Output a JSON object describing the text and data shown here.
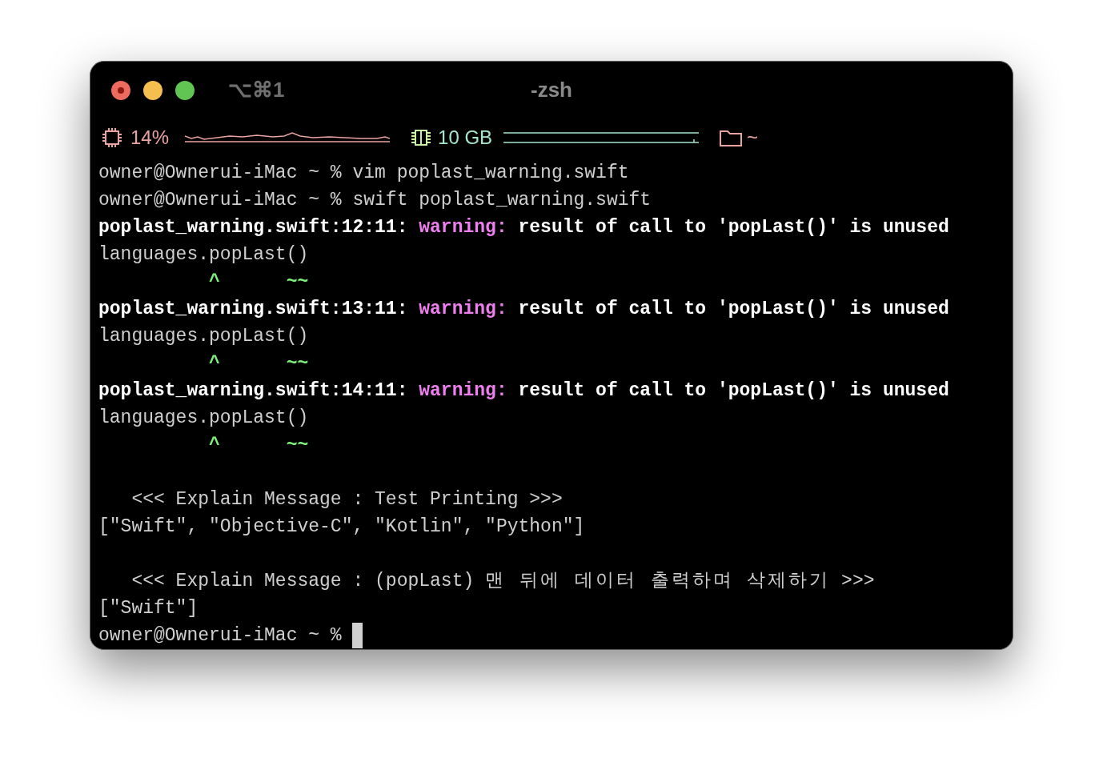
{
  "window": {
    "shortcut": "⌥⌘1",
    "title": "-zsh"
  },
  "status_bar": {
    "cpu": "14%",
    "memory": "10 GB",
    "directory": "~"
  },
  "lines": [
    {
      "segments": [
        {
          "kind": "plain",
          "text": "owner@Ownerui-iMac ~ % vim poplast_warning.swift"
        }
      ]
    },
    {
      "segments": [
        {
          "kind": "plain",
          "text": "owner@Ownerui-iMac ~ % swift poplast_warning.swift"
        }
      ]
    },
    {
      "segments": [
        {
          "kind": "bold",
          "text": "poplast_warning.swift:12:11: "
        },
        {
          "kind": "warning",
          "text": "warning:"
        },
        {
          "kind": "bold",
          "text": " result of call to 'popLast()' is unused"
        }
      ]
    },
    {
      "segments": [
        {
          "kind": "plain",
          "text": "languages.popLast()"
        }
      ]
    },
    {
      "segments": [
        {
          "kind": "marker",
          "text": "          ^      ~~"
        }
      ]
    },
    {
      "segments": [
        {
          "kind": "bold",
          "text": "poplast_warning.swift:13:11: "
        },
        {
          "kind": "warning",
          "text": "warning:"
        },
        {
          "kind": "bold",
          "text": " result of call to 'popLast()' is unused"
        }
      ]
    },
    {
      "segments": [
        {
          "kind": "plain",
          "text": "languages.popLast()"
        }
      ]
    },
    {
      "segments": [
        {
          "kind": "marker",
          "text": "          ^      ~~"
        }
      ]
    },
    {
      "segments": [
        {
          "kind": "bold",
          "text": "poplast_warning.swift:14:11: "
        },
        {
          "kind": "warning",
          "text": "warning:"
        },
        {
          "kind": "bold",
          "text": " result of call to 'popLast()' is unused"
        }
      ]
    },
    {
      "segments": [
        {
          "kind": "plain",
          "text": "languages.popLast()"
        }
      ]
    },
    {
      "segments": [
        {
          "kind": "marker",
          "text": "          ^      ~~"
        }
      ]
    },
    {
      "blank_before": true,
      "segments": [
        {
          "kind": "plain",
          "text": "   <<< Explain Message : Test Printing >>>"
        }
      ]
    },
    {
      "segments": [
        {
          "kind": "plain",
          "text": "[\"Swift\", \"Objective-C\", \"Kotlin\", \"Python\"]"
        }
      ]
    },
    {
      "blank_before": true,
      "segments": [
        {
          "kind": "plain",
          "text": "   <<< Explain Message : (popLast) "
        },
        {
          "kind": "wide",
          "text": "맨 뒤에 데이터 출력하며 삭제하기"
        },
        {
          "kind": "plain",
          "text": " >>>"
        }
      ]
    },
    {
      "segments": [
        {
          "kind": "plain",
          "text": "[\"Swift\"]"
        }
      ]
    },
    {
      "cursor": true,
      "segments": [
        {
          "kind": "plain",
          "text": "owner@Ownerui-iMac ~ % "
        }
      ]
    }
  ]
}
